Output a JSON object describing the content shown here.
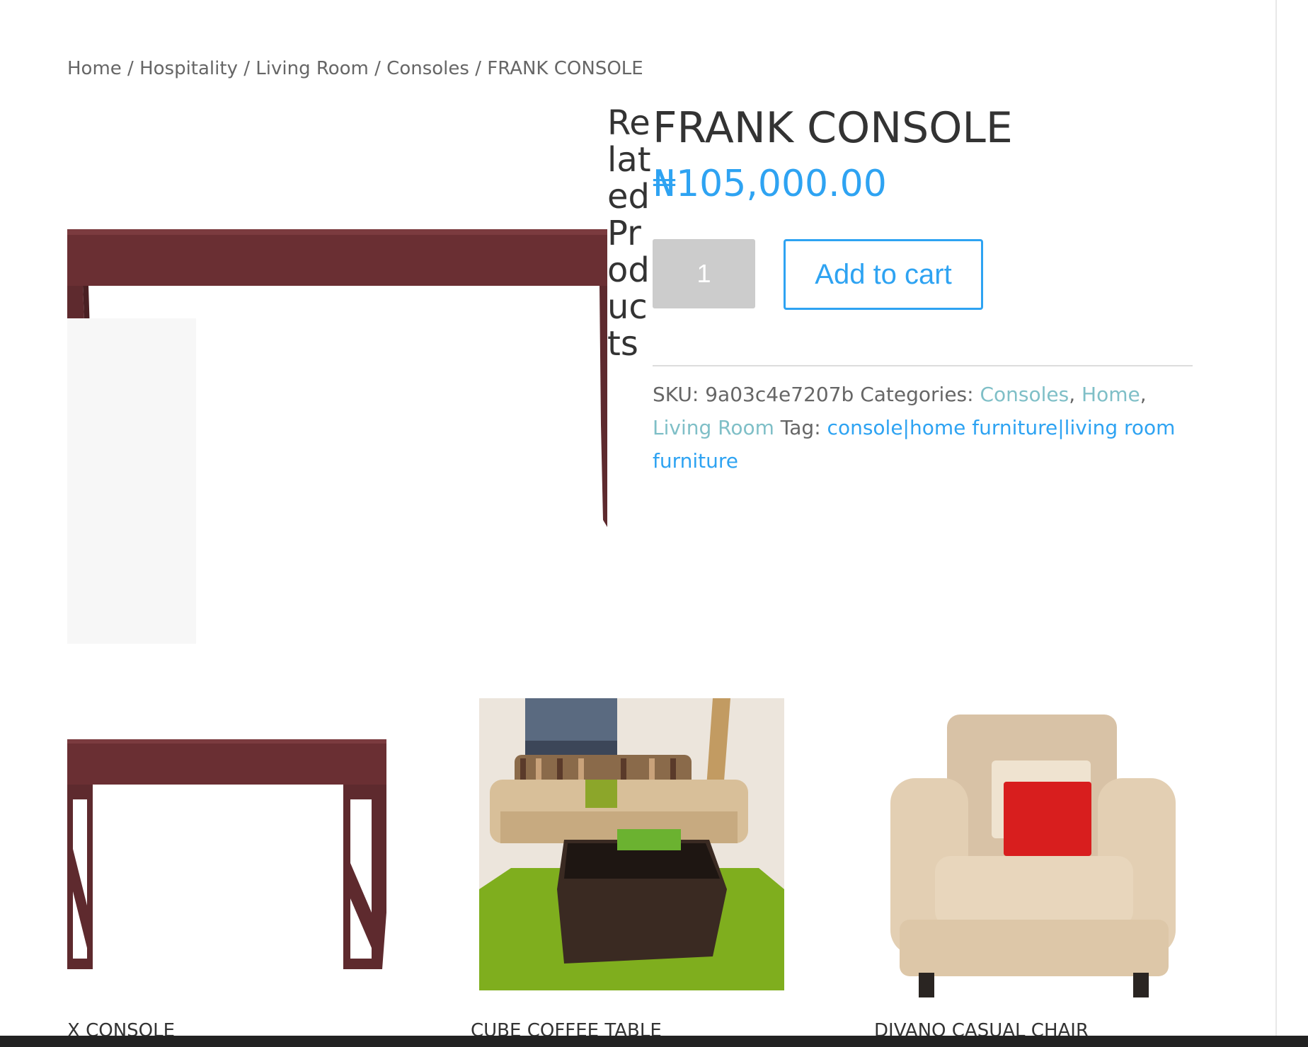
{
  "breadcrumb": {
    "items": [
      "Home",
      "Hospitality",
      "Living Room",
      "Consoles"
    ],
    "separator": " / ",
    "current": "FRANK CONSOLE"
  },
  "related_heading": "Related Products",
  "product": {
    "title": "FRANK CONSOLE",
    "price": "₦105,000.00",
    "quantity": "1",
    "add_to_cart_label": "Add to cart",
    "meta": {
      "sku_label": "SKU:",
      "sku": "9a03c4e7207b",
      "categories_label": "Categories:",
      "categories": [
        "Consoles",
        "Home",
        "Living Room"
      ],
      "tag_label": "Tag:",
      "tag": "console|home furniture|living room furniture"
    }
  },
  "related_products": [
    {
      "title": "X CONSOLE",
      "image": "x-console-table"
    },
    {
      "title": "CUBE COFFEE TABLE",
      "image": "living-room-sofa-coffee-table"
    },
    {
      "title": "DIVANO CASUAL CHAIR",
      "image": "beige-armchair-red-pillow"
    }
  ],
  "colors": {
    "accent": "#2ea3f2",
    "category_link": "#7fbfc7",
    "text": "#333333",
    "muted": "#666666",
    "wood": "#6a2f33"
  }
}
